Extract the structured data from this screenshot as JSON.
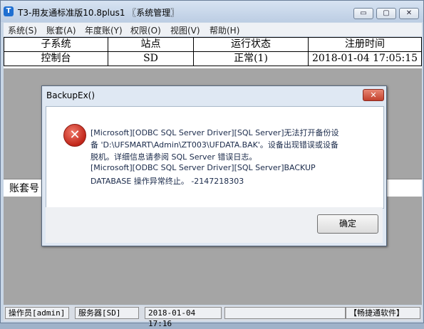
{
  "window": {
    "title": "T3-用友通标准版10.8plus1 〖系统管理〗",
    "app_icon_glyph": "T",
    "buttons": {
      "min": "▭",
      "max": "▢",
      "close": "✕"
    }
  },
  "menu": [
    {
      "label": "系统(S)"
    },
    {
      "label": "账套(A)"
    },
    {
      "label": "年度账(Y)"
    },
    {
      "label": "权限(O)"
    },
    {
      "label": "视图(V)"
    },
    {
      "label": "帮助(H)"
    }
  ],
  "table": {
    "headers": [
      "子系统",
      "站点",
      "运行状态",
      "注册时间"
    ],
    "rows": [
      [
        "控制台",
        "SD",
        "正常(1)",
        "2018-01-04 17:05:15"
      ]
    ]
  },
  "lower_panel": {
    "label": "账套号"
  },
  "statusbar": {
    "operator": "操作员[admin]",
    "server": "服务器[SD]",
    "datetime": "2018-01-04 17:16",
    "brand": "【畅捷通软件】"
  },
  "dialog": {
    "title": "BackupEx()",
    "close_glyph": "✕",
    "icon": "error-icon",
    "icon_glyph": "✕",
    "message_lines": [
      "[Microsoft][ODBC SQL Server Driver][SQL Server]无法打开备份设",
      "备 'D:\\UFSMART\\Admin\\ZT003\\UFDATA.BAK'。设备出现错误或设备",
      "脱机。详细信息请参阅 SQL Server 错误日志。",
      "[Microsoft][ODBC SQL Server Driver][SQL Server]BACKUP",
      "DATABASE 操作异常终止。 -2147218303"
    ],
    "ok_label": "确定"
  },
  "colors": {
    "error_red": "#c1261a",
    "close_red": "#c2402c",
    "panel_gray": "#a5a5a5"
  }
}
